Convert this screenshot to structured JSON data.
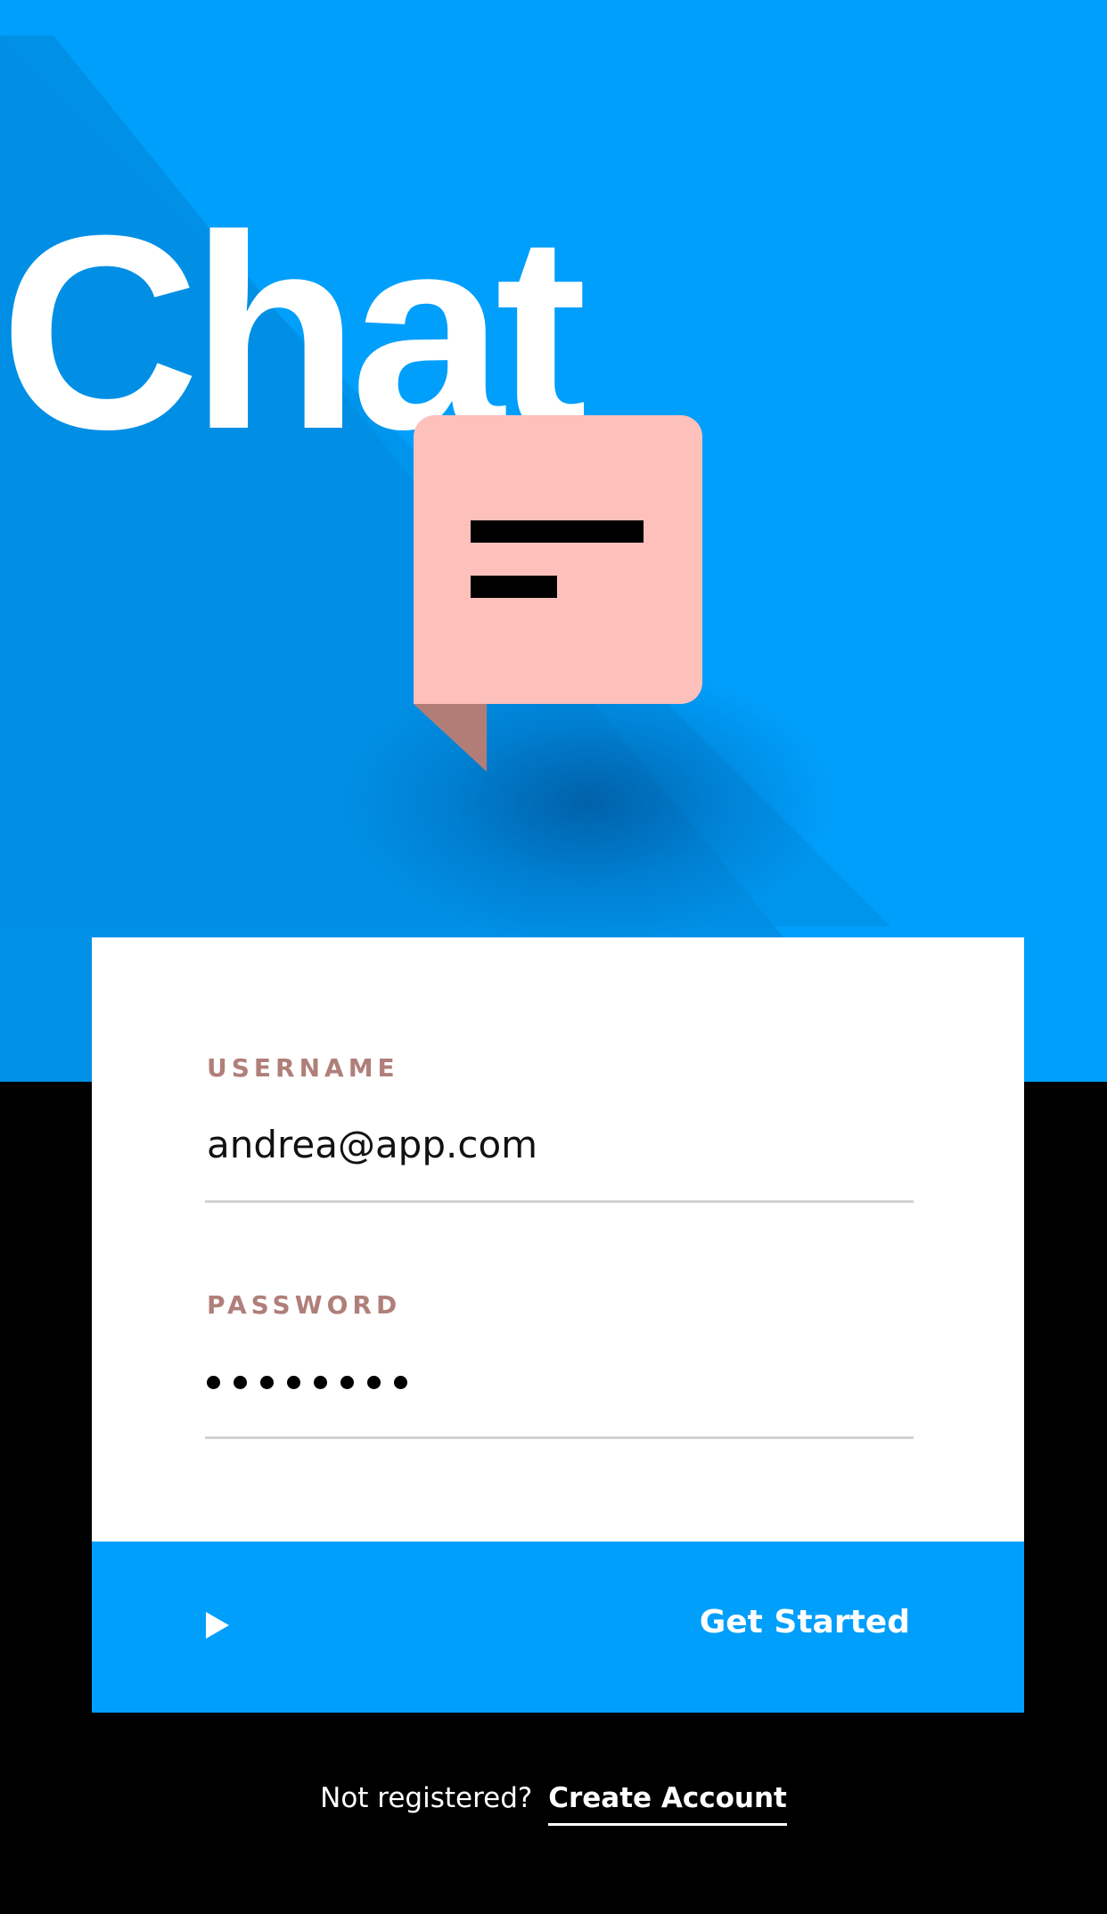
{
  "hero": {
    "title": "Chat",
    "icon": "chat-bubble-icon"
  },
  "login": {
    "username_label": "USERNAME",
    "username_value": "andrea@app.com",
    "password_label": "PASSWORD",
    "password_value": "••••••••",
    "password_length": 8
  },
  "cta": {
    "label": "Get Started",
    "icon": "play-icon"
  },
  "footer": {
    "prompt": "Not registered?",
    "link_label": "Create Account"
  },
  "colors": {
    "primary_blue": "#009ffb",
    "bubble_pink": "#fdc0bb",
    "bubble_tail": "#b27d77",
    "label_brown": "#b07f7a",
    "background": "#000000",
    "card": "#ffffff"
  }
}
